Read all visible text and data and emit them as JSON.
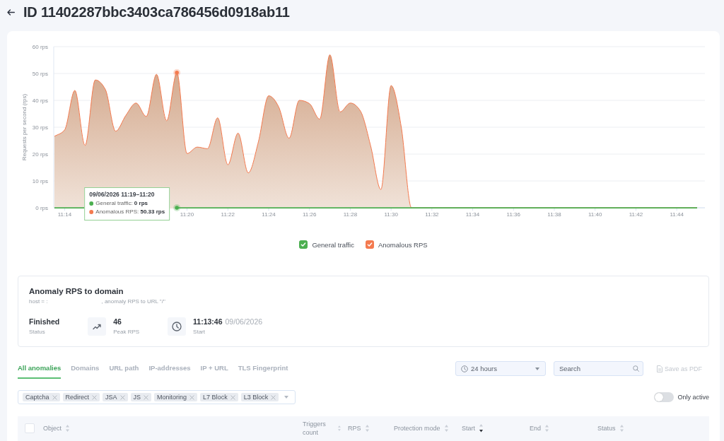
{
  "header": {
    "title": "ID 11402287bbc3403ca786456d0918ab11"
  },
  "chart": {
    "chart_data": {
      "type": "area",
      "ylabel": "Requests per second (rps)",
      "categories": [
        null,
        "11:14",
        null,
        null,
        null,
        null,
        null,
        null,
        null,
        null,
        null,
        null,
        null,
        "11:20",
        null,
        null,
        null,
        "11:22",
        null,
        null,
        null,
        "11:24",
        null,
        null,
        null,
        "11:26",
        null,
        null,
        null,
        "11:28",
        null,
        null,
        null,
        "11:30",
        null,
        null,
        null,
        "11:32",
        null,
        null,
        null,
        "11:34",
        null,
        null,
        null,
        "11:36",
        null,
        null,
        null,
        "11:38",
        null,
        null,
        null,
        "11:40",
        null,
        null,
        null,
        "11:42",
        null,
        null,
        null,
        "11:44",
        null,
        null
      ],
      "ylim": [
        0,
        60
      ],
      "yticks": [
        {
          "value": 0,
          "label": "0 rps"
        },
        {
          "value": 10,
          "label": "10 rps"
        },
        {
          "value": 20,
          "label": "20 rps"
        },
        {
          "value": 30,
          "label": "30 rps"
        },
        {
          "value": 40,
          "label": "40 rps"
        },
        {
          "value": 50,
          "label": "50 rps"
        },
        {
          "value": 60,
          "label": "60 rps"
        }
      ],
      "grid": true,
      "series": [
        {
          "name": "General traffic",
          "color": "#4caf50",
          "values": [
            0,
            0,
            0,
            0,
            null,
            null,
            null,
            null,
            null,
            null,
            null,
            null,
            0,
            0,
            0,
            0,
            0,
            0,
            0,
            0,
            0,
            0,
            0,
            0,
            0,
            0,
            0,
            0,
            0,
            0,
            0,
            0,
            0,
            0,
            0,
            0,
            0,
            0,
            0,
            0,
            0,
            0,
            0,
            0,
            0,
            0,
            0,
            0,
            0,
            0,
            0,
            0,
            0,
            0,
            0,
            0,
            0,
            0,
            0,
            0,
            0,
            0,
            0,
            0
          ]
        },
        {
          "name": "Anomalous RPS",
          "color": "#f47a4f",
          "values": [
            26.6,
            29,
            43.7,
            23.2,
            47.6,
            44,
            28.5,
            34.4,
            39,
            34,
            49.7,
            32.4,
            50.33,
            20.2,
            22.6,
            22,
            33.5,
            16,
            27.8,
            13,
            24.7,
            41.7,
            37.4,
            25.9,
            40,
            38.8,
            33,
            57,
            35.7,
            39,
            36,
            23,
            6.8,
            45.5,
            30,
            0,
            0,
            0,
            0,
            0,
            0,
            0,
            0,
            0,
            0,
            0,
            0,
            0,
            0,
            0,
            0,
            0,
            0,
            0,
            0,
            0,
            0,
            0,
            0,
            0,
            0,
            0,
            0,
            0
          ]
        }
      ]
    },
    "tooltip": {
      "title": "09/06/2026 11:19–11:20",
      "rows": [
        "General traffic: **0 rps**",
        "Anomalous RPS: **50.33 rps**"
      ]
    },
    "legend": [
      {
        "checked": true
      },
      {
        "checked": true
      }
    ]
  },
  "anomaly": {
    "title": "Anomaly RPS to domain",
    "description": [
      "host = :",
      ", anomaly RPS to URL \"/\""
    ],
    "stats": [
      {
        "kind": "status",
        "value": "Finished",
        "label": "Status"
      },
      {
        "kind": "peak",
        "value": "46",
        "label": "Peak RPS"
      },
      {
        "kind": "start",
        "value": "11:13:46",
        "date": "09/06/2026",
        "label": "Start"
      }
    ]
  },
  "tabs": [
    {
      "label": "All anomalies",
      "selected": true
    },
    {
      "label": "Domains",
      "selected": false
    },
    {
      "label": "URL path",
      "selected": false
    },
    {
      "label": "IP-addresses",
      "selected": false
    },
    {
      "label": "IP + URL",
      "selected": false
    },
    {
      "label": "TLS Fingerprint",
      "selected": false
    }
  ],
  "time_range": {
    "value": "24 hours"
  },
  "search": {
    "placeholder": "Search"
  },
  "save_pdf": {
    "label": "Save as PDF",
    "disabled": true
  },
  "filters": [
    "Captcha",
    "Redirect",
    "JSA",
    "JS",
    "Monitoring",
    "L7 Block",
    "L3 Block"
  ],
  "only_active": {
    "label": "Only active",
    "on": false
  },
  "table": {
    "select_all_checked": false,
    "columns": [
      {
        "label": "Object",
        "sorted": false
      },
      {
        "label": "Triggers count",
        "sorted": false
      },
      {
        "label": "RPS",
        "sorted": false
      },
      {
        "label": "Protection mode",
        "sorted": false
      },
      {
        "label": "Start",
        "sorted": true
      },
      {
        "label": "End",
        "sorted": false
      },
      {
        "label": "Status",
        "sorted": false
      }
    ]
  }
}
